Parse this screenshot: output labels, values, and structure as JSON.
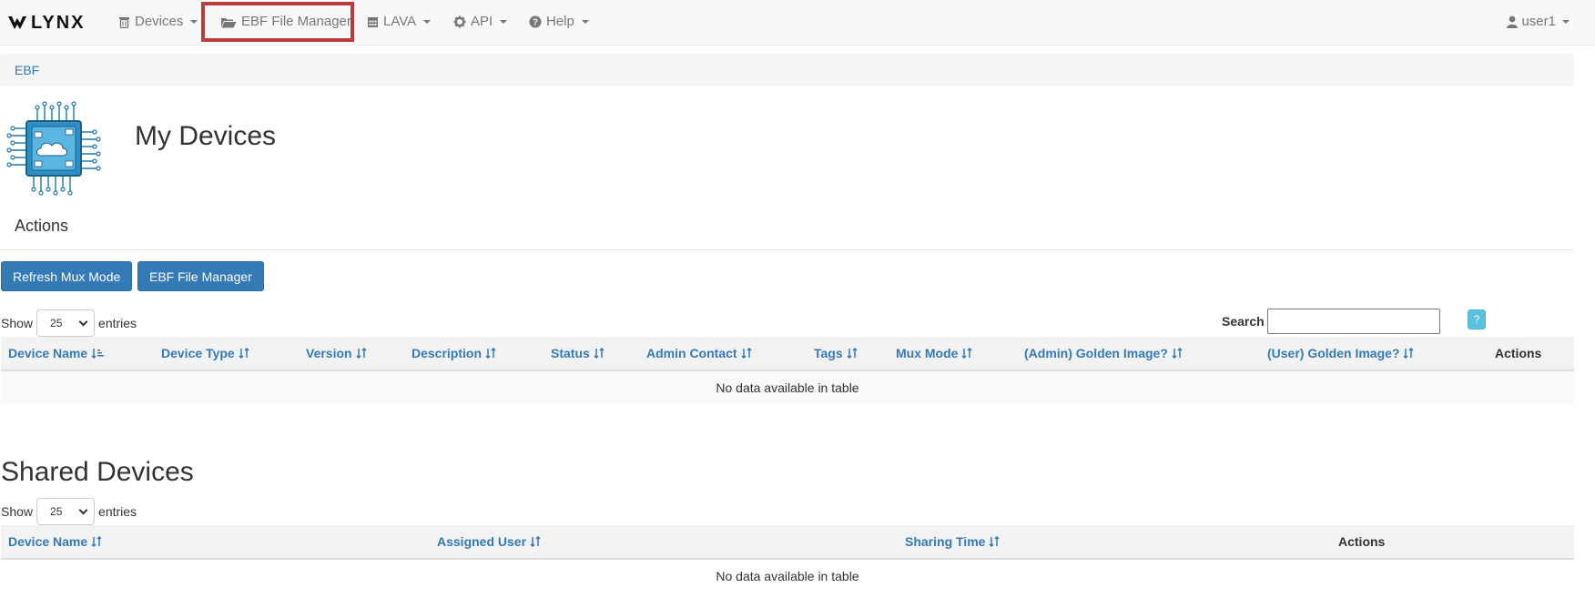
{
  "navbar": {
    "brand": "LYNX",
    "items": [
      {
        "label": "Devices",
        "icon": "trash-can-icon"
      },
      {
        "label": "EBF File Manager",
        "icon": "folder-open-icon"
      },
      {
        "label": "LAVA",
        "icon": "calendar-icon"
      },
      {
        "label": "API",
        "icon": "gear-icon"
      },
      {
        "label": "Help",
        "icon": "question-circle-icon"
      }
    ],
    "user": "user1"
  },
  "breadcrumb": {
    "label": "EBF"
  },
  "my_devices": {
    "title": "My Devices",
    "actions_heading": "Actions",
    "buttons": {
      "refresh": "Refresh Mux Mode",
      "file_manager": "EBF File Manager"
    },
    "show": {
      "prefix": "Show",
      "value": "25",
      "suffix": "entries"
    },
    "search_label": "Search",
    "search_value": "",
    "help_label": "?",
    "columns": [
      "Device Name",
      "Device Type",
      "Version",
      "Description",
      "Status",
      "Admin Contact",
      "Tags",
      "Mux Mode",
      "(Admin) Golden Image?",
      "(User) Golden Image?",
      "Actions"
    ],
    "empty_text": "No data available in table"
  },
  "shared_devices": {
    "title": "Shared Devices",
    "show": {
      "prefix": "Show",
      "value": "25",
      "suffix": "entries"
    },
    "columns": [
      "Device Name",
      "Assigned User",
      "Sharing Time",
      "Actions"
    ],
    "empty_text": "No data available in table"
  },
  "colors": {
    "link": "#337ab7",
    "button": "#337ab7",
    "highlight": "#b93d3d",
    "help": "#5bc0de"
  }
}
